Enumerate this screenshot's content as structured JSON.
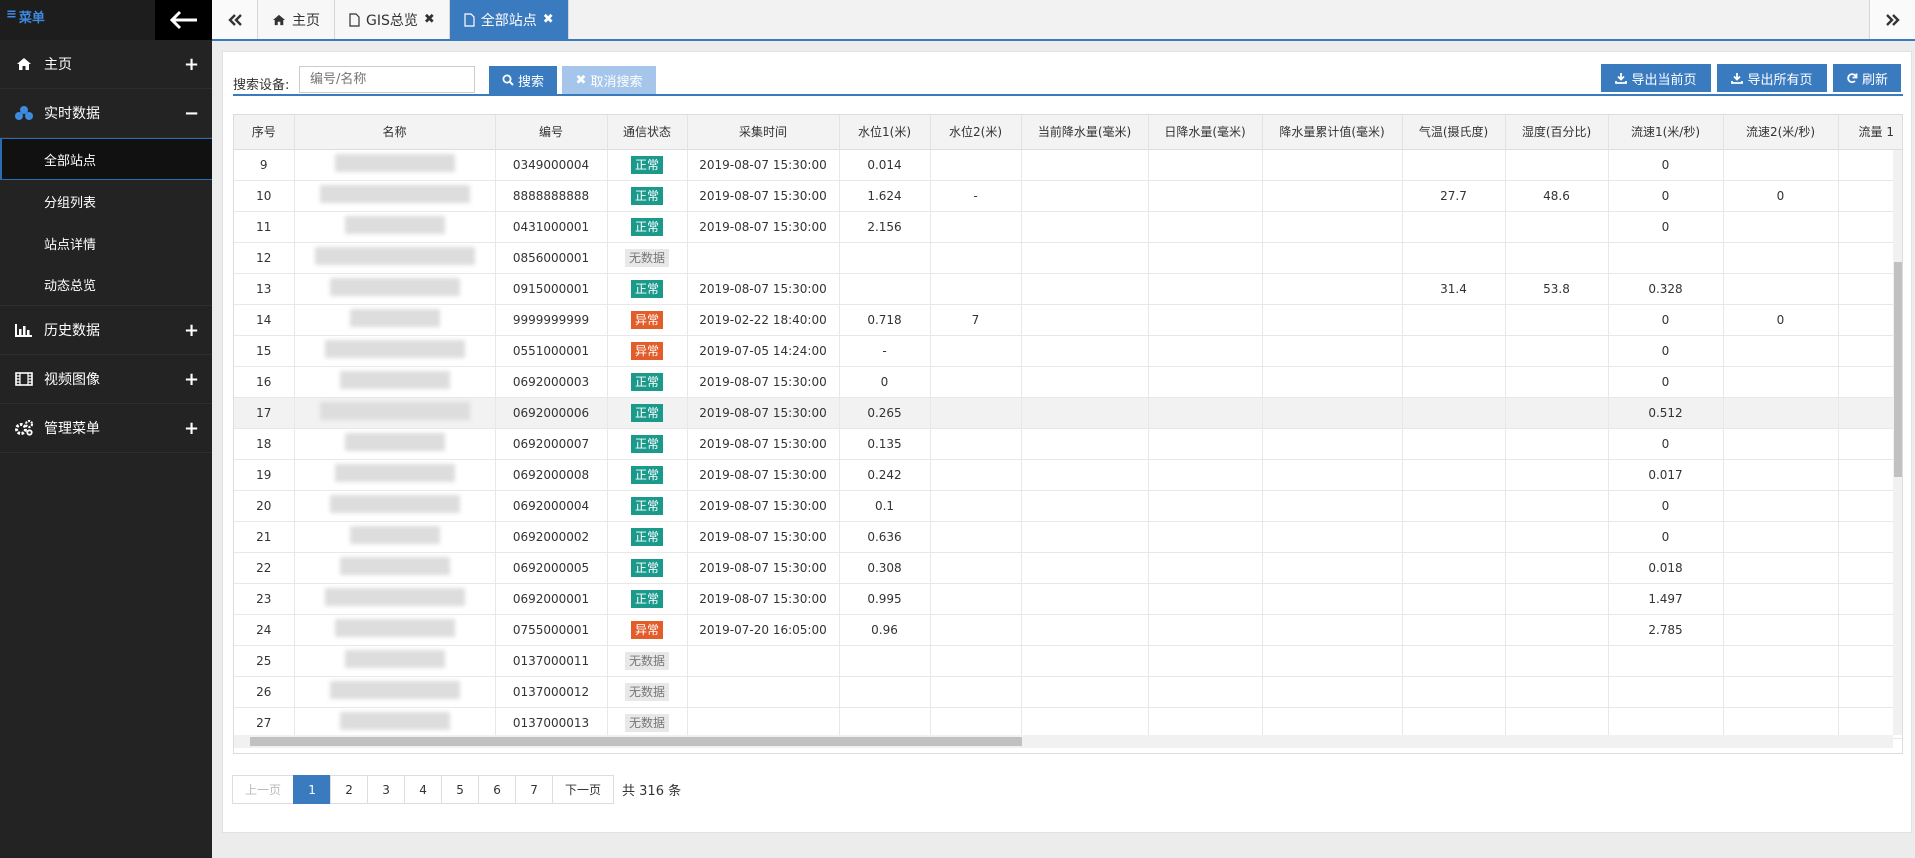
{
  "sidebar": {
    "menu_label": "菜单",
    "items": [
      {
        "label": "主页",
        "icon": "home-icon",
        "toggle": "+"
      },
      {
        "label": "实时数据",
        "icon": "cubes-icon",
        "toggle": "−"
      },
      {
        "label": "历史数据",
        "icon": "bar-chart-icon",
        "toggle": "+"
      },
      {
        "label": "视频图像",
        "icon": "film-icon",
        "toggle": "+"
      },
      {
        "label": "管理菜单",
        "icon": "gears-icon",
        "toggle": "+"
      }
    ],
    "subitems": [
      "全部站点",
      "分组列表",
      "站点详情",
      "动态总览"
    ]
  },
  "tabs": [
    {
      "label": "主页",
      "icon": "home-icon"
    },
    {
      "label": "GIS总览",
      "icon": "file-icon"
    },
    {
      "label": "全部站点",
      "icon": "file-icon"
    }
  ],
  "toolbar": {
    "search_label": "搜索设备:",
    "search_placeholder": "编号/名称",
    "search_btn": "搜索",
    "cancel_btn": "取消搜索",
    "export_current": "导出当前页",
    "export_all": "导出所有页",
    "refresh": "刷新"
  },
  "table": {
    "headers": [
      "序号",
      "名称",
      "编号",
      "通信状态",
      "采集时间",
      "水位1(米)",
      "水位2(米)",
      "当前降水量(毫米)",
      "日降水量(毫米)",
      "降水量累计值(毫米)",
      "气温(摄氏度)",
      "湿度(百分比)",
      "流速1(米/秒)",
      "流速2(米/秒)",
      "流量 1"
    ],
    "rows": [
      {
        "no": "9",
        "code": "0349000004",
        "status": "正常",
        "time": "2019-08-07 15:30:00",
        "wl1": "0.014",
        "wl2": "",
        "temp": "",
        "hum": "",
        "v1": "0",
        "v2": ""
      },
      {
        "no": "10",
        "code": "8888888888",
        "status": "正常",
        "time": "2019-08-07 15:30:00",
        "wl1": "1.624",
        "wl2": "-",
        "temp": "27.7",
        "hum": "48.6",
        "v1": "0",
        "v2": "0"
      },
      {
        "no": "11",
        "code": "0431000001",
        "status": "正常",
        "time": "2019-08-07 15:30:00",
        "wl1": "2.156",
        "wl2": "",
        "temp": "",
        "hum": "",
        "v1": "0",
        "v2": ""
      },
      {
        "no": "12",
        "code": "0856000001",
        "status": "无数据",
        "time": "",
        "wl1": "",
        "wl2": "",
        "temp": "",
        "hum": "",
        "v1": "",
        "v2": ""
      },
      {
        "no": "13",
        "code": "0915000001",
        "status": "正常",
        "time": "2019-08-07 15:30:00",
        "wl1": "",
        "wl2": "",
        "temp": "31.4",
        "hum": "53.8",
        "v1": "0.328",
        "v2": ""
      },
      {
        "no": "14",
        "code": "9999999999",
        "status": "异常",
        "time": "2019-02-22 18:40:00",
        "wl1": "0.718",
        "wl2": "7",
        "temp": "",
        "hum": "",
        "v1": "0",
        "v2": "0"
      },
      {
        "no": "15",
        "code": "0551000001",
        "status": "异常",
        "time": "2019-07-05 14:24:00",
        "wl1": "-",
        "wl2": "",
        "temp": "",
        "hum": "",
        "v1": "0",
        "v2": ""
      },
      {
        "no": "16",
        "code": "0692000003",
        "status": "正常",
        "time": "2019-08-07 15:30:00",
        "wl1": "0",
        "wl2": "",
        "temp": "",
        "hum": "",
        "v1": "0",
        "v2": ""
      },
      {
        "no": "17",
        "code": "0692000006",
        "status": "正常",
        "time": "2019-08-07 15:30:00",
        "wl1": "0.265",
        "wl2": "",
        "temp": "",
        "hum": "",
        "v1": "0.512",
        "v2": ""
      },
      {
        "no": "18",
        "code": "0692000007",
        "status": "正常",
        "time": "2019-08-07 15:30:00",
        "wl1": "0.135",
        "wl2": "",
        "temp": "",
        "hum": "",
        "v1": "0",
        "v2": ""
      },
      {
        "no": "19",
        "code": "0692000008",
        "status": "正常",
        "time": "2019-08-07 15:30:00",
        "wl1": "0.242",
        "wl2": "",
        "temp": "",
        "hum": "",
        "v1": "0.017",
        "v2": ""
      },
      {
        "no": "20",
        "code": "0692000004",
        "status": "正常",
        "time": "2019-08-07 15:30:00",
        "wl1": "0.1",
        "wl2": "",
        "temp": "",
        "hum": "",
        "v1": "0",
        "v2": ""
      },
      {
        "no": "21",
        "code": "0692000002",
        "status": "正常",
        "time": "2019-08-07 15:30:00",
        "wl1": "0.636",
        "wl2": "",
        "temp": "",
        "hum": "",
        "v1": "0",
        "v2": ""
      },
      {
        "no": "22",
        "code": "0692000005",
        "status": "正常",
        "time": "2019-08-07 15:30:00",
        "wl1": "0.308",
        "wl2": "",
        "temp": "",
        "hum": "",
        "v1": "0.018",
        "v2": ""
      },
      {
        "no": "23",
        "code": "0692000001",
        "status": "正常",
        "time": "2019-08-07 15:30:00",
        "wl1": "0.995",
        "wl2": "",
        "temp": "",
        "hum": "",
        "v1": "1.497",
        "v2": ""
      },
      {
        "no": "24",
        "code": "0755000001",
        "status": "异常",
        "time": "2019-07-20 16:05:00",
        "wl1": "0.96",
        "wl2": "",
        "temp": "",
        "hum": "",
        "v1": "2.785",
        "v2": ""
      },
      {
        "no": "25",
        "code": "0137000011",
        "status": "无数据",
        "time": "",
        "wl1": "",
        "wl2": "",
        "temp": "",
        "hum": "",
        "v1": "",
        "v2": ""
      },
      {
        "no": "26",
        "code": "0137000012",
        "status": "无数据",
        "time": "",
        "wl1": "",
        "wl2": "",
        "temp": "",
        "hum": "",
        "v1": "",
        "v2": ""
      },
      {
        "no": "27",
        "code": "0137000013",
        "status": "无数据",
        "time": "",
        "wl1": "",
        "wl2": "",
        "temp": "",
        "hum": "",
        "v1": "",
        "v2": ""
      }
    ],
    "highlighted_row": "17"
  },
  "pagination": {
    "prev": "上一页",
    "pages": [
      "1",
      "2",
      "3",
      "4",
      "5",
      "6",
      "7"
    ],
    "current": "1",
    "next": "下一页",
    "total": "共 316 条"
  },
  "colors": {
    "accent": "#3a7bc0",
    "status_ok": "#1b9a8c",
    "status_err": "#e35d2a",
    "sidebar_bg": "#232323"
  }
}
